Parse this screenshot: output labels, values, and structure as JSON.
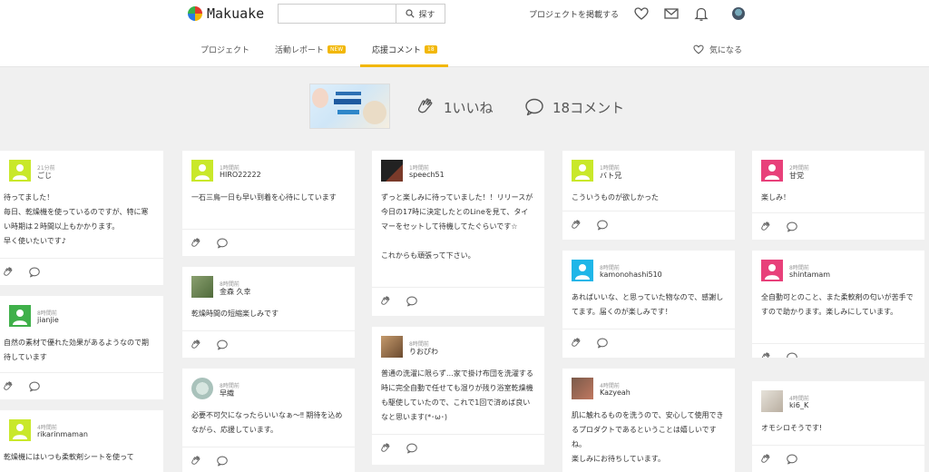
{
  "header": {
    "logo_text": "Makuake",
    "search_placeholder": "",
    "search_button": "探す",
    "post_project": "プロジェクトを掲載する",
    "icons": [
      "heart-icon",
      "mail-icon",
      "bell-icon",
      "avatar"
    ]
  },
  "tabs": [
    {
      "label": "プロジェクト",
      "badge": ""
    },
    {
      "label": "活動レポート",
      "badge": "NEW"
    },
    {
      "label": "応援コメント",
      "badge": "18",
      "active": true
    }
  ],
  "favorite_label": "気になる",
  "project": {
    "likes_label": "1いいね",
    "comments_label": "18コメント",
    "thumb_text_1": "no more",
    "thumb_text_2": "ふわっ"
  },
  "colors": {
    "accent": "#f2b705",
    "avatar_lime": "#c9e82a",
    "avatar_green": "#3fb04a",
    "avatar_cyan": "#1fb6e8",
    "avatar_pink": "#e8407a"
  },
  "columns": [
    [
      {
        "time": "21分前",
        "user": "ごじ",
        "text": "待ってました！\n毎日、乾燥機を使っているのですが、特に寒い時期は２時間以上もかかります。\n早く使いたいです♪"
      },
      {
        "time": "8時間前",
        "user": "jianjie",
        "text": "自然の素材で優れた効果があるようなので期待しています"
      },
      {
        "time": "4時間前",
        "user": "rikarinmaman",
        "text": "乾燥機にはいつも柔軟剤シートを使って"
      }
    ],
    [
      {
        "time": "1時間前",
        "user": "HIRO22222",
        "text": "一石三鳥一日も早い到着を心待にしています"
      },
      {
        "time": "8時間前",
        "user": "金森 久幸",
        "text": "乾燥時間の短縮楽しみです"
      },
      {
        "time": "8時間前",
        "user": "早織",
        "text": "必要不可欠になったらいいなぁ〜‼ 期待を込めながら、応援しています。"
      }
    ],
    [
      {
        "time": "1時間前",
        "user": "speech51",
        "text": "ずっと楽しみに待っていました！！リリースが今日の17時に決定したとのLineを見て、タイマーをセットして待機してたぐらいです☆\n\nこれからも頑張って下さい。"
      },
      {
        "time": "8時間前",
        "user": "りおぴわ",
        "text": "普通の洗濯に限らず…家で掛け布団を洗濯する時に完全自動で任せても湿りが残り浴室乾燥機も駆使していたので、これで1回で済めば良いなと思います(*･ω･)"
      }
    ],
    [
      {
        "time": "1時間前",
        "user": "バト兄",
        "text": "こういうものが欲しかった"
      },
      {
        "time": "8時間前",
        "user": "kamonohashi510",
        "text": "あればいいな、と思っていた物なので、感謝してます。届くのが楽しみです！"
      },
      {
        "time": "4時間前",
        "user": "Kazyeah",
        "text": "肌に触れるものを洗うので、安心して使用できるプロダクトであるということは嬉しいですね。\n楽しみにお待ちしています。"
      }
    ],
    [
      {
        "time": "2時間前",
        "user": "甘党",
        "text": "楽しみ！"
      },
      {
        "time": "8時間前",
        "user": "shintamam",
        "text": "全自動可とのこと、また柔軟剤の匂いが苦手ですので助かります。楽しみにしています。"
      },
      {
        "time": "4時間前",
        "user": "ki6_K",
        "text": "オモシロそうです!"
      }
    ]
  ]
}
